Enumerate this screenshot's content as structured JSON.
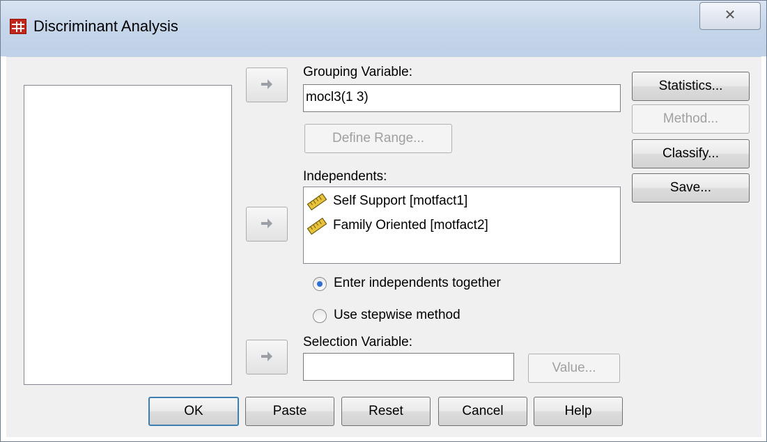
{
  "window": {
    "title": "Discriminant Analysis",
    "close_glyph": "✕",
    "icon": "spss-table-icon"
  },
  "source_variables": [],
  "grouping": {
    "label": "Grouping Variable:",
    "value": "mocl3(1 3)",
    "define_range_label": "Define Range..."
  },
  "independents": {
    "label": "Independents:",
    "items": [
      {
        "label": "Self Support [motfact1]",
        "icon": "scale-ruler-icon"
      },
      {
        "label": "Family Oriented [motfact2]",
        "icon": "scale-ruler-icon"
      }
    ]
  },
  "method_options": {
    "enter_label": "Enter independents together",
    "stepwise_label": "Use stepwise method",
    "selected": "enter"
  },
  "selection": {
    "label": "Selection Variable:",
    "value": "",
    "value_button": "Value..."
  },
  "side_buttons": {
    "statistics": "Statistics...",
    "method": "Method...",
    "classify": "Classify...",
    "save": "Save..."
  },
  "bottom_buttons": {
    "ok": "OK",
    "paste": "Paste",
    "reset": "Reset",
    "cancel": "Cancel",
    "help": "Help"
  },
  "colors": {
    "accent": "#2d6fd3",
    "icon_red": "#c4261b",
    "ruler_yellow": "#e8c23a"
  }
}
